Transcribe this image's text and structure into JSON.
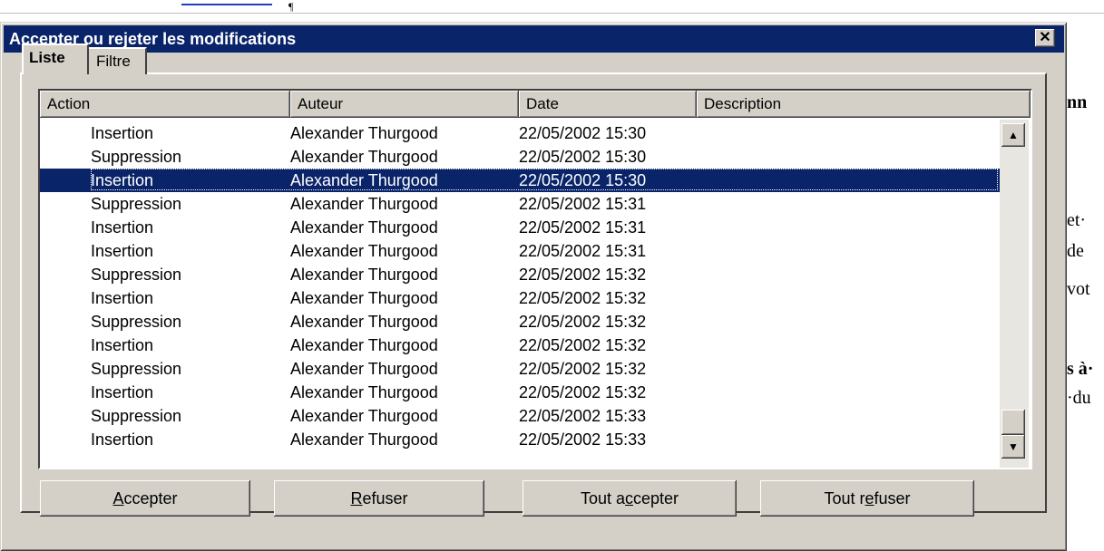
{
  "window": {
    "title": "Accepter ou rejeter les modifications",
    "close_glyph": "✕"
  },
  "background_doc": {
    "text_fragments": [
      "nn",
      "et·",
      "de",
      "vot",
      "s à·",
      "·du"
    ],
    "link_tick": "¶"
  },
  "tabs": [
    {
      "label": "Liste",
      "selected": true
    },
    {
      "label": "Filtre",
      "selected": false
    }
  ],
  "list": {
    "columns": [
      "Action",
      "Auteur",
      "Date",
      "Description"
    ],
    "rows": [
      {
        "action": "Insertion",
        "author": "Alexander Thurgood",
        "date": "22/05/2002 15:30",
        "description": "",
        "selected": false
      },
      {
        "action": "Suppression",
        "author": "Alexander Thurgood",
        "date": "22/05/2002 15:30",
        "description": "",
        "selected": false
      },
      {
        "action": "Insertion",
        "author": "Alexander Thurgood",
        "date": "22/05/2002 15:30",
        "description": "",
        "selected": true
      },
      {
        "action": "Suppression",
        "author": "Alexander Thurgood",
        "date": "22/05/2002 15:31",
        "description": "",
        "selected": false
      },
      {
        "action": "Insertion",
        "author": "Alexander Thurgood",
        "date": "22/05/2002 15:31",
        "description": "",
        "selected": false
      },
      {
        "action": "Insertion",
        "author": "Alexander Thurgood",
        "date": "22/05/2002 15:31",
        "description": "",
        "selected": false
      },
      {
        "action": "Suppression",
        "author": "Alexander Thurgood",
        "date": "22/05/2002 15:32",
        "description": "",
        "selected": false
      },
      {
        "action": "Insertion",
        "author": "Alexander Thurgood",
        "date": "22/05/2002 15:32",
        "description": "",
        "selected": false
      },
      {
        "action": "Suppression",
        "author": "Alexander Thurgood",
        "date": "22/05/2002 15:32",
        "description": "",
        "selected": false
      },
      {
        "action": "Insertion",
        "author": "Alexander Thurgood",
        "date": "22/05/2002 15:32",
        "description": "",
        "selected": false
      },
      {
        "action": "Suppression",
        "author": "Alexander Thurgood",
        "date": "22/05/2002 15:32",
        "description": "",
        "selected": false
      },
      {
        "action": "Insertion",
        "author": "Alexander Thurgood",
        "date": "22/05/2002 15:32",
        "description": "",
        "selected": false
      },
      {
        "action": "Suppression",
        "author": "Alexander Thurgood",
        "date": "22/05/2002 15:33",
        "description": "",
        "selected": false
      },
      {
        "action": "Insertion",
        "author": "Alexander Thurgood",
        "date": "22/05/2002 15:33",
        "description": "",
        "selected": false
      }
    ]
  },
  "scrollbar": {
    "up_glyph": "▲",
    "down_glyph": "▼"
  },
  "buttons": {
    "accept": {
      "pre": "",
      "key": "A",
      "post": "ccepter"
    },
    "reject": {
      "pre": "",
      "key": "R",
      "post": "efuser"
    },
    "accept_all": {
      "pre": "Tout a",
      "key": "c",
      "post": "cepter"
    },
    "reject_all": {
      "pre": "Tout r",
      "key": "e",
      "post": "fuser"
    }
  },
  "colors": {
    "dialog_face": "#d4d0c8",
    "title_bar": "#0a246a",
    "selection": "#0a246a"
  }
}
